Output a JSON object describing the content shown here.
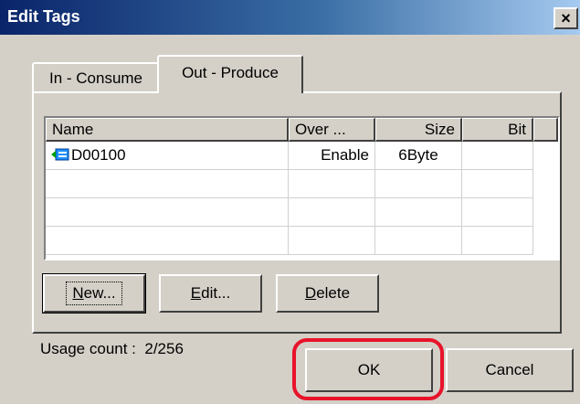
{
  "window": {
    "title": "Edit Tags",
    "close_label": "×"
  },
  "tabs": [
    {
      "label": "In - Consume",
      "active": false
    },
    {
      "label": "Out - Produce",
      "active": true
    }
  ],
  "table": {
    "columns": [
      "Name",
      "Over ...",
      "Size",
      "Bit"
    ],
    "rows": [
      {
        "name": "D00100",
        "over": "Enable",
        "size": "6Byte",
        "bit": ""
      }
    ]
  },
  "buttons": {
    "new": {
      "mnemonic": "N",
      "rest": "ew..."
    },
    "edit": {
      "mnemonic": "E",
      "rest": "dit..."
    },
    "delete": {
      "mnemonic": "D",
      "rest": "elete"
    },
    "ok": "OK",
    "cancel": "Cancel"
  },
  "usage": {
    "label": "Usage count :",
    "value": "2/256"
  },
  "colors": {
    "title_gradient_start": "#0a246a",
    "highlight": "#e8132b",
    "face": "#d4d0c8"
  },
  "icons": {
    "tag_row": "tag-icon"
  }
}
